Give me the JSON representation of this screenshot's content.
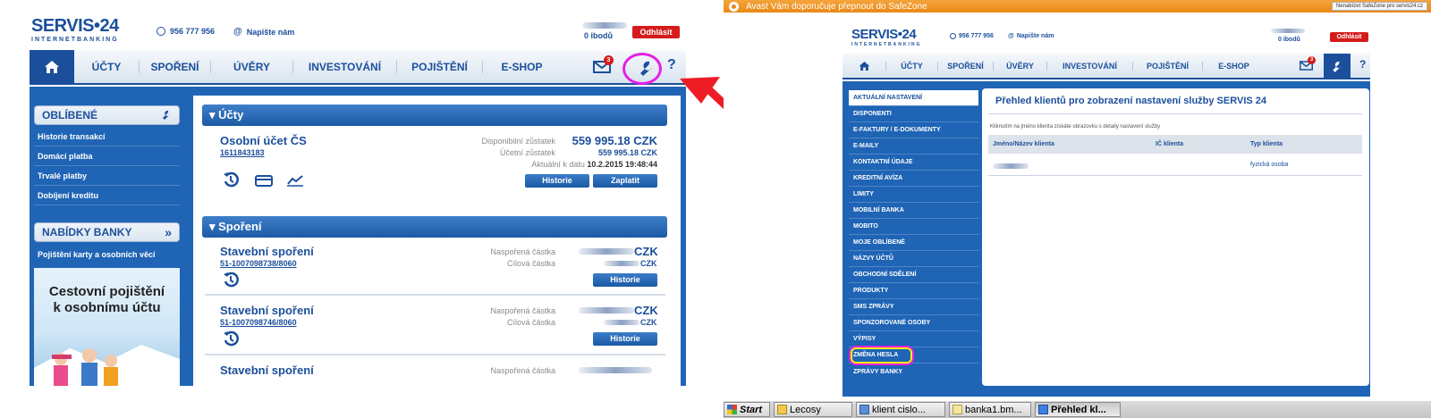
{
  "left_screen": {
    "logo": {
      "name": "SERVIS•24",
      "subtitle": "INTERNETBANKING"
    },
    "header": {
      "phone": "956 777 956",
      "contact": "Napište nám",
      "points": "0 ibodů",
      "logout": "Odhlásit"
    },
    "nav": {
      "items": [
        "ÚČTY",
        "SPOŘENÍ",
        "ÚVĚRY",
        "INVESTOVÁNÍ",
        "POJIŠTĚNÍ",
        "E-SHOP"
      ],
      "mail_badge": "3",
      "help": "?"
    },
    "sidebar": {
      "favorites_title": "OBLÍBENÉ",
      "favorites": [
        "Historie transakcí",
        "Domácí platba",
        "Trvalé platby",
        "Dobíjení kreditu"
      ],
      "offers_title": "NABÍDKY BANKY",
      "offers_link": "Pojištění karty a osobních věcí",
      "promo_line1": "Cestovní pojištění",
      "promo_line2": "k osobnímu účtu"
    },
    "accounts": {
      "section_title": "▾ Účty",
      "name": "Osobní účet ČS",
      "number": "1611843183",
      "available_label": "Disponibilní zůstatek",
      "available_value": "559 995.18 CZK",
      "book_label": "Účetní zůstatek",
      "book_value": "559 995.18 CZK",
      "updated_label": "Aktuální k datu",
      "updated_value": "10.2.2015 19:48:44",
      "btn_history": "Historie",
      "btn_pay": "Zaplatit"
    },
    "savings": {
      "section_title": "▾ Spoření",
      "items": [
        {
          "name": "Stavební spoření",
          "number": "51-1007098738/8060",
          "saved_label": "Naspořená částka",
          "target_label": "Cílová částka",
          "currency": "CZK",
          "btn": "Historie"
        },
        {
          "name": "Stavební spoření",
          "number": "51-1007098746/8060",
          "saved_label": "Naspořená částka",
          "target_label": "Cílová částka",
          "currency": "CZK",
          "btn": "Historie"
        },
        {
          "name": "Stavební spoření",
          "saved_label": "Naspořená částka"
        }
      ]
    }
  },
  "right_screen": {
    "avast_message": "Avast Vám doporučuje přepnout do SafeZone",
    "avast_button": "Nenabízet SafeZone pro servis24.cz",
    "logo": {
      "name": "SERVIS•24",
      "subtitle": "INTERNETBANKING"
    },
    "header": {
      "phone": "956 777 956",
      "contact": "Napište nám",
      "points": "0 ibodů",
      "logout": "Odhlásit"
    },
    "nav": {
      "items": [
        "ÚČTY",
        "SPOŘENÍ",
        "ÚVĚRY",
        "INVESTOVÁNÍ",
        "POJIŠTĚNÍ",
        "E-SHOP"
      ],
      "mail_badge": "3",
      "help": "?"
    },
    "settings_menu": [
      "AKTUÁLNÍ NASTAVENÍ",
      "DISPONENTI",
      "E-FAKTURY / E-DOKUMENTY",
      "E-MAILY",
      "KONTAKTNÍ ÚDAJE",
      "KREDITNÍ AVÍZA",
      "LIMITY",
      "MOBILNÍ BANKA",
      "MOBITO",
      "MOJE OBLÍBENÉ",
      "NÁZVY ÚČTŮ",
      "OBCHODNÍ SDĚLENÍ",
      "PRODUKTY",
      "SMS ZPRÁVY",
      "SPONZOROVANÉ OSOBY",
      "VÝPISY",
      "ZMĚNA HESLA",
      "ZPRÁVY BANKY"
    ],
    "content": {
      "title": "Přehled klientů pro zobrazení nastavení služby SERVIS 24",
      "hint": "Kliknutím na jméno klienta získáte obrazovku s detaily nastavení služby",
      "col_name": "Jméno/Název klienta",
      "col_ic": "IČ klienta",
      "col_type": "Typ klienta",
      "row_type": "fyzická osoba"
    },
    "taskbar": {
      "start": "Start",
      "items": [
        "Lecosy",
        "klient cislo...",
        "banka1.bm...",
        "Přehled kl..."
      ]
    }
  },
  "colors": {
    "brand_blue": "#1b4f9c",
    "panel_blue": "#1f64b5",
    "logout_red": "#d41c1c",
    "annotation_red": "#ee1c25",
    "highlight_magenta": "#e61ee6",
    "highlight_yellow": "#f2f20a",
    "avast_orange": "#ee8f1c"
  }
}
